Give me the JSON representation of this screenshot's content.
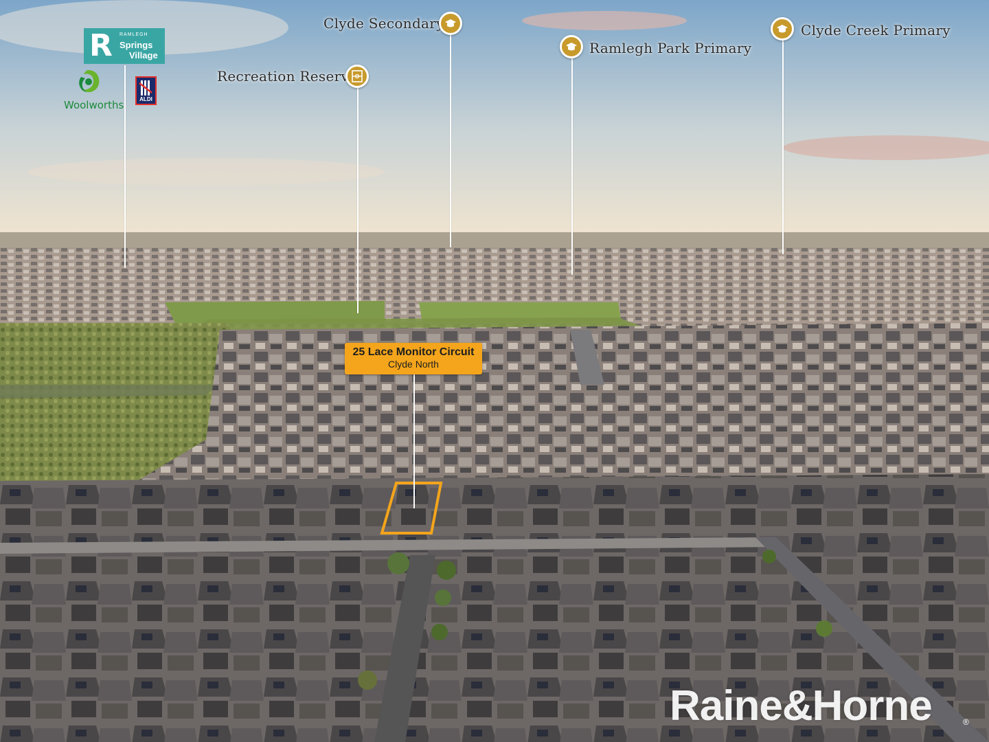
{
  "scene": {
    "colors": {
      "sky_top": "#7da6c9",
      "sky_bottom": "#f1e6d2",
      "gold": "#c79a2b",
      "tag": "#f4a51c"
    }
  },
  "logos": {
    "ramlegh": {
      "small": "RAMLEGH",
      "name_line1": "Springs",
      "name_line2": "Village",
      "letter": "R"
    },
    "woolworths": "Woolworths",
    "aldi": "ALDI",
    "agency": "Raine&Horne",
    "agency_mark": "®"
  },
  "pois": {
    "clyde_secondary": {
      "label": "Clyde Secondary",
      "icon": "graduation-cap-icon"
    },
    "ramlegh_park": {
      "label": "Ramlegh Park Primary",
      "icon": "graduation-cap-icon"
    },
    "clyde_creek": {
      "label": "Clyde Creek Primary",
      "icon": "graduation-cap-icon"
    },
    "recreation": {
      "label": "Recreation Reserve",
      "icon": "sports-field-icon"
    }
  },
  "property": {
    "address": "25 Lace Monitor Circuit",
    "suburb": "Clyde North"
  }
}
